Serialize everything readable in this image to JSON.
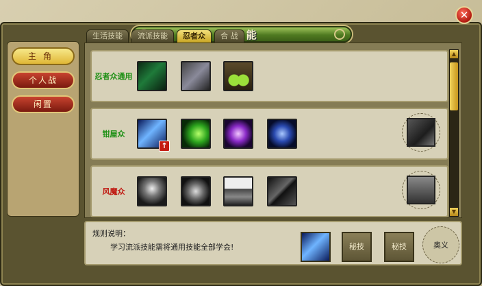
{
  "title": "技 能",
  "tabs": [
    {
      "label": "生活技能",
      "active": false
    },
    {
      "label": "流派技能",
      "active": false
    },
    {
      "label": "忍者众",
      "active": true
    },
    {
      "label": "合 战",
      "active": false
    }
  ],
  "side_menu": [
    {
      "label": "主角",
      "active": true
    },
    {
      "label": "个人战",
      "active": false
    },
    {
      "label": "闲置",
      "active": false
    }
  ],
  "rows": [
    {
      "label": "忍者众通用",
      "color": "#1b8f13",
      "skills": [
        "green-slash-icon",
        "dark-storm-icon",
        "green-orbs-icon"
      ],
      "has_ring": false
    },
    {
      "label": "钳屋众",
      "color": "#1b8f13",
      "skills": [
        "blue-lightning-icon",
        "green-wind-icon",
        "purple-burst-icon",
        "blue-bird-icon"
      ],
      "has_ring": true
    },
    {
      "label": "风魔众",
      "color": "#c01a12",
      "skills": [
        "grey-spike-icon",
        "grey-blast-icon",
        "castle-icon",
        "dark-shuriken-icon"
      ],
      "has_ring": true
    }
  ],
  "info": {
    "title": "规则说明：",
    "text": "学习流派技能需将通用技能全部学会!",
    "slots": [
      "秘技",
      "秘技"
    ],
    "ring_label": "奥义"
  },
  "upgrade_icon": "up-arrow-icon",
  "colors": {
    "accent_green": "#4f7a21",
    "active_gold": "#e0b736",
    "button_red": "#b11a10"
  }
}
